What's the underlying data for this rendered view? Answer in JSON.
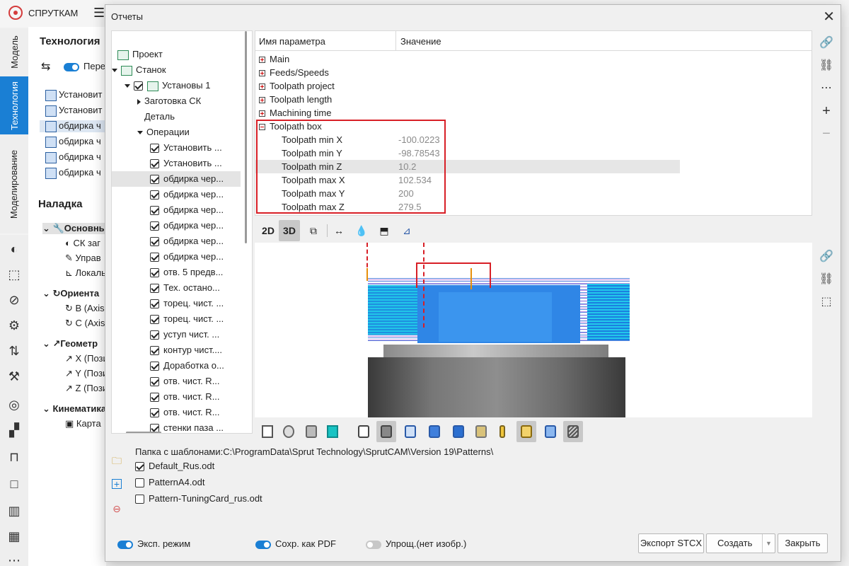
{
  "app": {
    "name": "СПРУТКАМ",
    "side_tabs": [
      "Модель",
      "Технология",
      "Моделирование"
    ],
    "bg_panel": {
      "title": "Технология",
      "toggle_label": "Пере",
      "ops": [
        "Установит",
        "Установит",
        "обдирка ч",
        "обдирка ч",
        "обдирка ч",
        "обдирка ч"
      ],
      "setup_title": "Наладка",
      "groups": [
        {
          "label": "Основны",
          "items": [
            "СК заг",
            "Управ",
            "Локаль"
          ]
        },
        {
          "label": "Ориента",
          "items": [
            "B (Axis",
            "C (Axis"
          ]
        },
        {
          "label": "Геометр",
          "items": [
            "X (Пози",
            "Y (Пози",
            "Z (Пози"
          ]
        },
        {
          "label": "Кинематика",
          "items": [
            "Карта"
          ]
        }
      ]
    }
  },
  "dialog": {
    "title": "Отчеты",
    "tree": {
      "project": "Проект",
      "machine": "Станок",
      "setup": "Установы 1",
      "stock_cs": "Заготовка СК",
      "part": "Деталь",
      "operations": "Операции",
      "ops": [
        "Установить ...",
        "Установить ...",
        "обдирка чер...",
        "обдирка чер...",
        "обдирка чер...",
        "обдирка чер...",
        "обдирка чер...",
        "обдирка чер...",
        "отв. 5 предв...",
        "Тех. остано...",
        "торец. чист. ...",
        "торец. чист. ...",
        "уступ чист. ...",
        "контур чист....",
        "Доработка о...",
        "отв. чист. R...",
        "отв. чист. R...",
        "отв. чист. R...",
        "стенки паза ..."
      ]
    },
    "params": {
      "col_name": "Имя параметра",
      "col_value": "Значение",
      "groups": [
        "Main",
        "Feeds/Speeds",
        "Toolpath project",
        "Toolpath length",
        "Machining time",
        "Toolpath box"
      ],
      "box_rows": [
        {
          "name": "Toolpath min X",
          "value": "-100.0223"
        },
        {
          "name": "Toolpath min Y",
          "value": "-98.78543"
        },
        {
          "name": "Toolpath min Z",
          "value": "10.2"
        },
        {
          "name": "Toolpath max X",
          "value": "102.534"
        },
        {
          "name": "Toolpath max Y",
          "value": "200"
        },
        {
          "name": "Toolpath max Z",
          "value": "279.5"
        }
      ]
    },
    "view_toolbar": {
      "btn_2d": "2D",
      "btn_3d": "3D"
    },
    "templates": {
      "folder_path": "Папка с шаблонами:C:\\ProgramData\\Sprut Technology\\SprutCAM\\Version 19\\Patterns\\",
      "items": [
        {
          "name": "Default_Rus.odt",
          "checked": true
        },
        {
          "name": "PatternA4.odt",
          "checked": false
        },
        {
          "name": "Pattern-TuningCard_rus.odt",
          "checked": false
        }
      ]
    },
    "footer": {
      "exp_mode": "Эксп. режим",
      "save_pdf": "Сохр. как PDF",
      "simplified": "Упрощ.(нет изобр.)",
      "export_btn": "Экспорт STCX",
      "create_btn": "Создать",
      "close_btn": "Закрыть"
    }
  },
  "colors": {
    "accent": "#1a7fd4",
    "highlight_box": "#d81f26"
  }
}
